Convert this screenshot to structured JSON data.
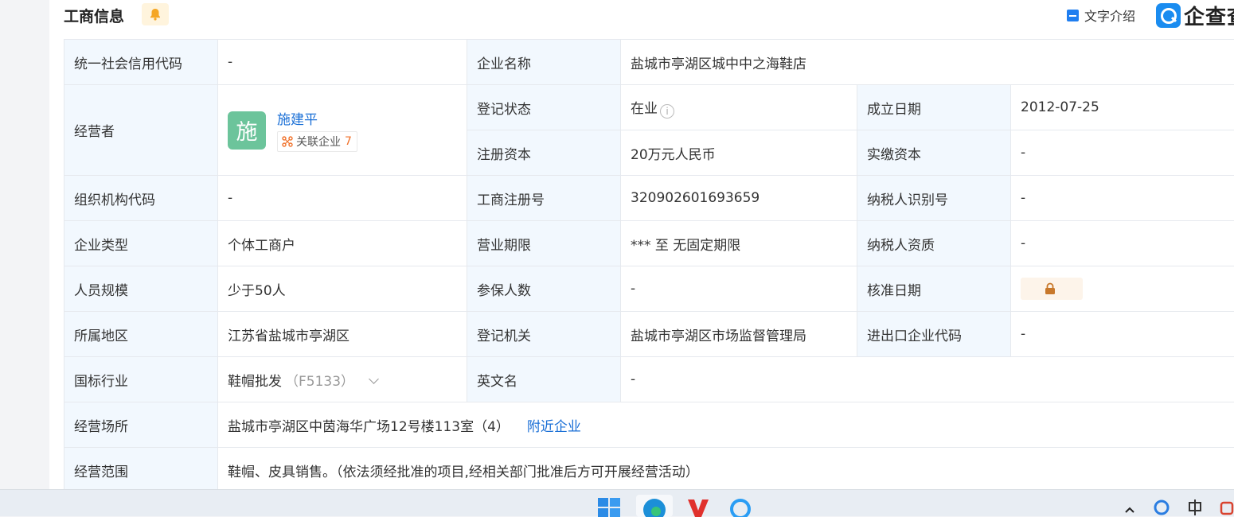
{
  "header": {
    "title": "工商信息",
    "text_intro_label": "文字介绍",
    "logo_text": "企查查"
  },
  "table": {
    "credit_code": {
      "label": "统一社会信用代码",
      "value": "-"
    },
    "company_name": {
      "label": "企业名称",
      "value": "盐城市亭湖区城中中之海鞋店"
    },
    "operator": {
      "label": "经营者",
      "avatar_char": "施",
      "name": "施建平",
      "related_label": "关联企业",
      "related_count": "7"
    },
    "reg_status": {
      "label": "登记状态",
      "value": "在业"
    },
    "founded": {
      "label": "成立日期",
      "value": "2012-07-25"
    },
    "reg_capital": {
      "label": "注册资本",
      "value": "20万元人民币"
    },
    "paid_capital": {
      "label": "实缴资本",
      "value": "-"
    },
    "org_code": {
      "label": "组织机构代码",
      "value": "-"
    },
    "reg_number": {
      "label": "工商注册号",
      "value": "320902601693659"
    },
    "taxpayer_id": {
      "label": "纳税人识别号",
      "value": "-"
    },
    "company_type": {
      "label": "企业类型",
      "value": "个体工商户"
    },
    "business_term": {
      "label": "营业期限",
      "value": "*** 至 无固定期限"
    },
    "taxpayer_qual": {
      "label": "纳税人资质",
      "value": "-"
    },
    "staff_size": {
      "label": "人员规模",
      "value": "少于50人"
    },
    "insured": {
      "label": "参保人数",
      "value": "-"
    },
    "approval_date": {
      "label": "核准日期"
    },
    "region": {
      "label": "所属地区",
      "value": "江苏省盐城市亭湖区"
    },
    "authority": {
      "label": "登记机关",
      "value": "盐城市亭湖区市场监督管理局"
    },
    "import_export": {
      "label": "进出口企业代码",
      "value": "-"
    },
    "industry": {
      "label": "国标行业",
      "value": "鞋帽批发",
      "code": "（F5133）"
    },
    "english_name": {
      "label": "英文名",
      "value": "-"
    },
    "address": {
      "label": "经营场所",
      "value": "盐城市亭湖区中茵海华广场12号楼113室（4）",
      "nearby_link": "附近企业"
    },
    "scope": {
      "label": "经营范围",
      "value": "鞋帽、皮具销售。（依法须经批准的项目,经相关部门批准后方可开展经营活动）"
    }
  },
  "colors": {
    "label_bg": "#f2f8fe",
    "link": "#1a6fd6",
    "accent_orange": "#f0712a",
    "avatar_green": "#6cc49b"
  },
  "taskbar": {
    "icons": [
      "windows-start-icon",
      "edge-browser-icon",
      "wps-icon",
      "search-app-icon",
      "tray-chevron-icon",
      "tray-network-icon",
      "tray-input-icon",
      "tray-app-icon"
    ]
  }
}
